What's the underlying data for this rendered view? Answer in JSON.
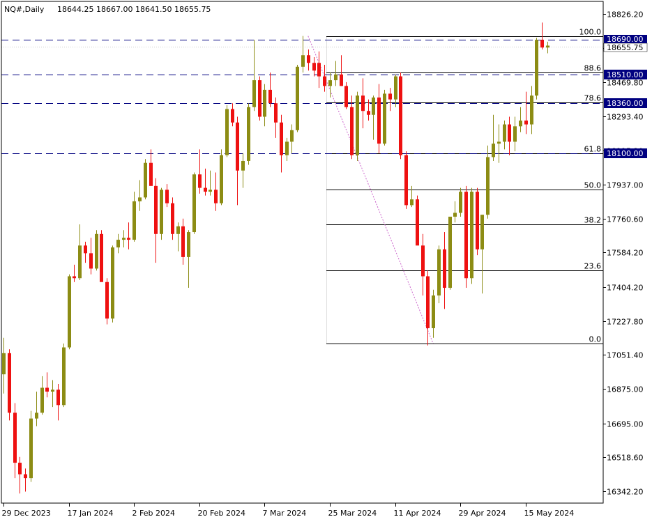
{
  "header": {
    "symbol": "NQ#,Daily",
    "ohlc": "18644.25 18667.00 18641.50 18655.75"
  },
  "colors": {
    "bull": "#8c8c14",
    "bear": "#ee1111",
    "grid": "#000000",
    "level_line": "#000080",
    "label_bg": "#000080",
    "fib_diagonal": "#cc66cc"
  },
  "chart_data": {
    "type": "candlestick",
    "ylim": [
      16280,
      18890
    ],
    "y_ticks": [
      "18826.20",
      "18648.00",
      "18469.80",
      "18293.40",
      "18115.20",
      "17937.00",
      "17760.60",
      "17584.20",
      "17404.20",
      "17227.80",
      "17051.40",
      "16875.00",
      "16695.00",
      "16518.60",
      "16342.20"
    ],
    "x_labels": [
      {
        "label": "29 Dec 2023",
        "index": 0
      },
      {
        "label": "17 Jan 2024",
        "index": 12
      },
      {
        "label": "2 Feb 2024",
        "index": 24
      },
      {
        "label": "20 Feb 2024",
        "index": 36
      },
      {
        "label": "7 Mar 2024",
        "index": 48
      },
      {
        "label": "25 Mar 2024",
        "index": 60
      },
      {
        "label": "11 Apr 2024",
        "index": 72
      },
      {
        "label": "29 Apr 2024",
        "index": 84
      },
      {
        "label": "15 May 2024",
        "index": 96
      }
    ],
    "candles": [
      [
        16950,
        17140,
        16850,
        17060
      ],
      [
        17060,
        17080,
        16710,
        16750
      ],
      [
        16750,
        16800,
        16410,
        16490
      ],
      [
        16490,
        16520,
        16330,
        16430
      ],
      [
        16430,
        16460,
        16340,
        16410
      ],
      [
        16410,
        16760,
        16390,
        16720
      ],
      [
        16720,
        16860,
        16680,
        16750
      ],
      [
        16750,
        16940,
        16740,
        16880
      ],
      [
        16880,
        16960,
        16830,
        16860
      ],
      [
        16860,
        16920,
        16780,
        16870
      ],
      [
        16870,
        16900,
        16710,
        16790
      ],
      [
        16790,
        17110,
        16780,
        17090
      ],
      [
        17090,
        17470,
        17080,
        17460
      ],
      [
        17460,
        17520,
        17430,
        17450
      ],
      [
        17450,
        17730,
        17440,
        17620
      ],
      [
        17620,
        17640,
        17530,
        17580
      ],
      [
        17580,
        17660,
        17470,
        17500
      ],
      [
        17500,
        17700,
        17490,
        17680
      ],
      [
        17680,
        17700,
        17460,
        17430
      ],
      [
        17430,
        17450,
        17210,
        17240
      ],
      [
        17240,
        17620,
        17220,
        17610
      ],
      [
        17610,
        17680,
        17580,
        17650
      ],
      [
        17650,
        17700,
        17610,
        17660
      ],
      [
        17660,
        17740,
        17600,
        17650
      ],
      [
        17650,
        17900,
        17640,
        17850
      ],
      [
        17850,
        17960,
        17800,
        17870
      ],
      [
        17870,
        18070,
        17860,
        18050
      ],
      [
        18050,
        18120,
        17940,
        17930
      ],
      [
        17930,
        17970,
        17530,
        17680
      ],
      [
        17680,
        17920,
        17650,
        17910
      ],
      [
        17910,
        17940,
        17820,
        17840
      ],
      [
        17840,
        17870,
        17650,
        17680
      ],
      [
        17680,
        17740,
        17590,
        17720
      ],
      [
        17720,
        17760,
        17520,
        17560
      ],
      [
        17560,
        17700,
        17400,
        17690
      ],
      [
        17690,
        18000,
        17680,
        17990
      ],
      [
        17990,
        18120,
        17890,
        17920
      ],
      [
        17920,
        18020,
        17880,
        17900
      ],
      [
        17900,
        18010,
        17880,
        17910
      ],
      [
        17910,
        18000,
        17800,
        17840
      ],
      [
        17840,
        18120,
        17830,
        18090
      ],
      [
        18090,
        18350,
        18080,
        18330
      ],
      [
        18330,
        18360,
        18240,
        18260
      ],
      [
        18260,
        18290,
        17830,
        18010
      ],
      [
        18010,
        18100,
        17920,
        18060
      ],
      [
        18060,
        18360,
        18040,
        18340
      ],
      [
        18340,
        18690,
        18320,
        18480
      ],
      [
        18480,
        18500,
        18270,
        18290
      ],
      [
        18290,
        18460,
        18240,
        18430
      ],
      [
        18430,
        18520,
        18340,
        18360
      ],
      [
        18360,
        18390,
        18180,
        18260
      ],
      [
        18260,
        18300,
        18000,
        18090
      ],
      [
        18090,
        18180,
        18060,
        18160
      ],
      [
        18160,
        18250,
        18100,
        18220
      ],
      [
        18220,
        18560,
        18210,
        18550
      ],
      [
        18550,
        18710,
        18520,
        18610
      ],
      [
        18610,
        18640,
        18530,
        18570
      ],
      [
        18570,
        18600,
        18500,
        18530
      ],
      [
        18570,
        18630,
        18440,
        18500
      ],
      [
        18500,
        18560,
        18420,
        18450
      ],
      [
        18450,
        18520,
        18390,
        18480
      ],
      [
        18480,
        18580,
        18450,
        18510
      ],
      [
        18510,
        18610,
        18450,
        18450
      ],
      [
        18450,
        18470,
        18330,
        18340
      ],
      [
        18340,
        18400,
        18070,
        18090
      ],
      [
        18090,
        18420,
        18060,
        18400
      ],
      [
        18400,
        18490,
        18230,
        18320
      ],
      [
        18320,
        18380,
        18270,
        18300
      ],
      [
        18300,
        18400,
        18170,
        18390
      ],
      [
        18390,
        18460,
        18100,
        18150
      ],
      [
        18150,
        18430,
        18140,
        18410
      ],
      [
        18410,
        18440,
        18320,
        18380
      ],
      [
        18380,
        18510,
        18340,
        18500
      ],
      [
        18500,
        18520,
        18070,
        18090
      ],
      [
        18090,
        18110,
        17810,
        17830
      ],
      [
        17830,
        17930,
        17820,
        17860
      ],
      [
        17860,
        17880,
        17660,
        17620
      ],
      [
        17620,
        17680,
        17360,
        17460
      ],
      [
        17460,
        17490,
        17100,
        17190
      ],
      [
        17190,
        17390,
        17140,
        17360
      ],
      [
        17360,
        17620,
        17320,
        17600
      ],
      [
        17600,
        17690,
        17290,
        17400
      ],
      [
        17400,
        17770,
        17390,
        17770
      ],
      [
        17770,
        17850,
        17740,
        17790
      ],
      [
        17790,
        17920,
        17770,
        17900
      ],
      [
        17900,
        17930,
        17400,
        17450
      ],
      [
        17450,
        17920,
        17420,
        17900
      ],
      [
        17900,
        17920,
        17570,
        17600
      ],
      [
        17600,
        17780,
        17370,
        17780
      ],
      [
        17780,
        18140,
        17760,
        18080
      ],
      [
        18080,
        18300,
        18060,
        18150
      ],
      [
        18150,
        18250,
        18050,
        18160
      ],
      [
        18160,
        18270,
        18120,
        18250
      ],
      [
        18250,
        18290,
        18090,
        18160
      ],
      [
        18160,
        18290,
        18110,
        18240
      ],
      [
        18240,
        18340,
        18210,
        18270
      ],
      [
        18270,
        18420,
        18200,
        18250
      ],
      [
        18250,
        18450,
        18200,
        18400
      ],
      [
        18400,
        18700,
        18380,
        18690
      ],
      [
        18690,
        18780,
        18640,
        18650
      ],
      [
        18650,
        18680,
        18620,
        18660
      ]
    ],
    "fib_levels": [
      {
        "label": "100.0",
        "value": 18710
      },
      {
        "label": "88.6",
        "value": 18520
      },
      {
        "label": "78.6",
        "value": 18365
      },
      {
        "label": "61.8",
        "value": 18100
      },
      {
        "label": "50.0",
        "value": 17910
      },
      {
        "label": "38.2",
        "value": 17730
      },
      {
        "label": "23.6",
        "value": 17490
      },
      {
        "label": "0.0",
        "value": 17110
      }
    ],
    "fib_swing": {
      "from_index": 56,
      "from_value": 18710,
      "to_index": 79,
      "to_value": 17110
    },
    "h_levels": [
      {
        "label": "18690.00",
        "value": 18690
      },
      {
        "label": "18510.00",
        "value": 18510
      },
      {
        "label": "18360.00",
        "value": 18360
      },
      {
        "label": "18100.00",
        "value": 18100
      }
    ],
    "current_price": {
      "label": "18655.75",
      "value": 18655.75
    }
  }
}
